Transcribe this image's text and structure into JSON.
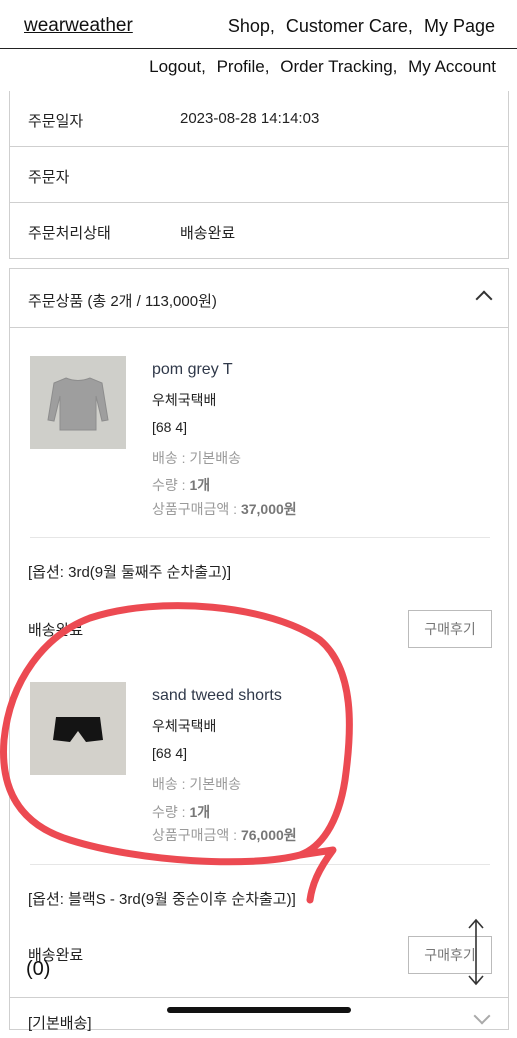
{
  "nav": {
    "brand": "wearweather",
    "primary": [
      "Shop,",
      "Customer Care,",
      "My Page"
    ],
    "secondary": [
      "Logout,",
      "Profile,",
      "Order Tracking,",
      "My Account"
    ]
  },
  "order_info": [
    {
      "label": "주문일자",
      "value": "2023-08-28 14:14:03"
    },
    {
      "label": "주문자",
      "value": ""
    },
    {
      "label": "주문처리상태",
      "value": "배송완료"
    }
  ],
  "order_items": {
    "header": "주문상품 (총 2개 / 113,000원)",
    "items": [
      {
        "name": "pom grey T",
        "carrier": "우체국택배",
        "tracking": "[68        4]",
        "shipping": "배송 : 기본배송",
        "qty_label": "수량 : ",
        "qty": "1개",
        "price_label": "상품구매금액 : ",
        "price": "37,000원",
        "option": "[옵션: 3rd(9월 둘째주 순차출고)]",
        "status": "배송완료",
        "review_button": "구매후기"
      },
      {
        "name": "sand tweed shorts",
        "carrier": "우체국택배",
        "tracking": "[68        4]",
        "shipping": "배송 : 기본배송",
        "qty_label": "수량 : ",
        "qty": "1개",
        "price_label": "상품구매금액 : ",
        "price": "76,000원",
        "option": "[옵션: 블랙S - 3rd(9월 중순이후 순차출고)]",
        "status": "배송완료",
        "review_button": "구매후기"
      }
    ],
    "shipping_section": "[기본배송]"
  },
  "cart_count": "(0)",
  "colors": {
    "annotation": "#ec4a52",
    "border": "#cfcfcf",
    "muted": "#9a9a9a"
  }
}
